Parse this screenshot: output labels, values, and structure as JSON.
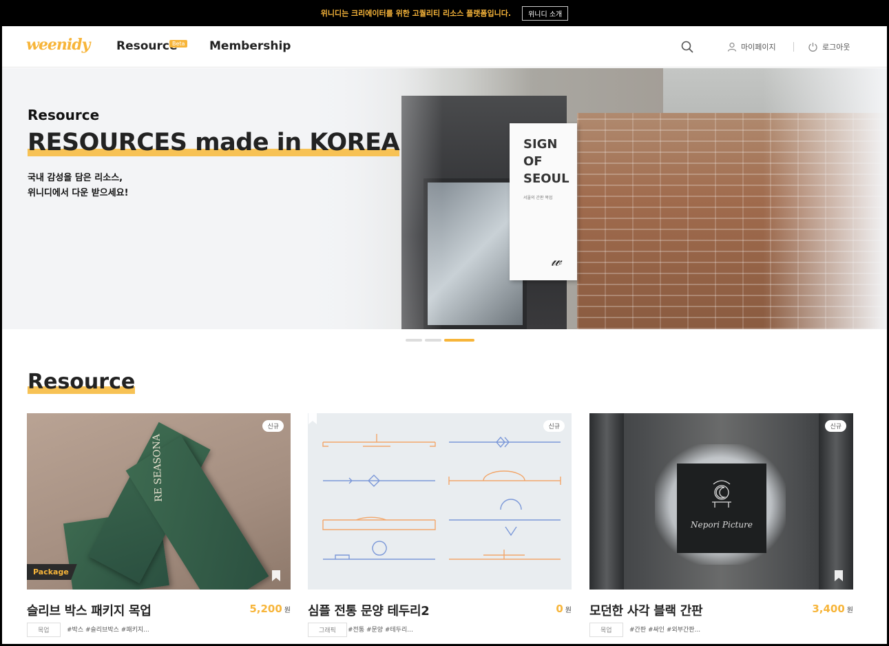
{
  "notice": {
    "message": "위니디는 크리에이터를 위한 고퀄리티 리소스 플랫폼입니다.",
    "button": "위니디 소개"
  },
  "header": {
    "logo": "weenidy",
    "nav": [
      {
        "label": "Resource",
        "badge": "Beta"
      },
      {
        "label": "Membership"
      }
    ],
    "mypage": "마이페이지",
    "logout": "로그아웃"
  },
  "hero": {
    "subtitle": "Resource",
    "title": "RESOURCES made in KOREA",
    "desc_line1": "국내 감성을 담은 리소스,",
    "desc_line2": "위니디에서 다운 받으세요!",
    "sign_text": [
      "SIGN",
      "OF",
      "SEOUL"
    ],
    "sign_small": "서울의 간판 목업",
    "slide_count": 3,
    "active_slide": 3
  },
  "section": {
    "title": "Resource"
  },
  "cards": [
    {
      "title": "슬리브 박스 패키지 목업",
      "price": "5,200",
      "unit": "원",
      "category": "목업",
      "tags": "#박스 #슬리브박스 #패키지...",
      "badge": "신규",
      "label": "Package",
      "image_text": "RE SEASONA"
    },
    {
      "title": "심플 전통 문양 테두리2",
      "price": "0",
      "unit": "원",
      "category": "그래픽",
      "tags": "#전통 #문양 #테두리...",
      "badge": "신규"
    },
    {
      "title": "모던한 사각 블랙 간판",
      "price": "3,400",
      "unit": "원",
      "category": "목업",
      "tags": "#간판 #싸인 #외부간판...",
      "badge": "신규",
      "image_text": "Nepori Picture"
    }
  ],
  "colors": {
    "accent": "#f7b53a",
    "highlight": "#f7c255",
    "text": "#222222"
  }
}
